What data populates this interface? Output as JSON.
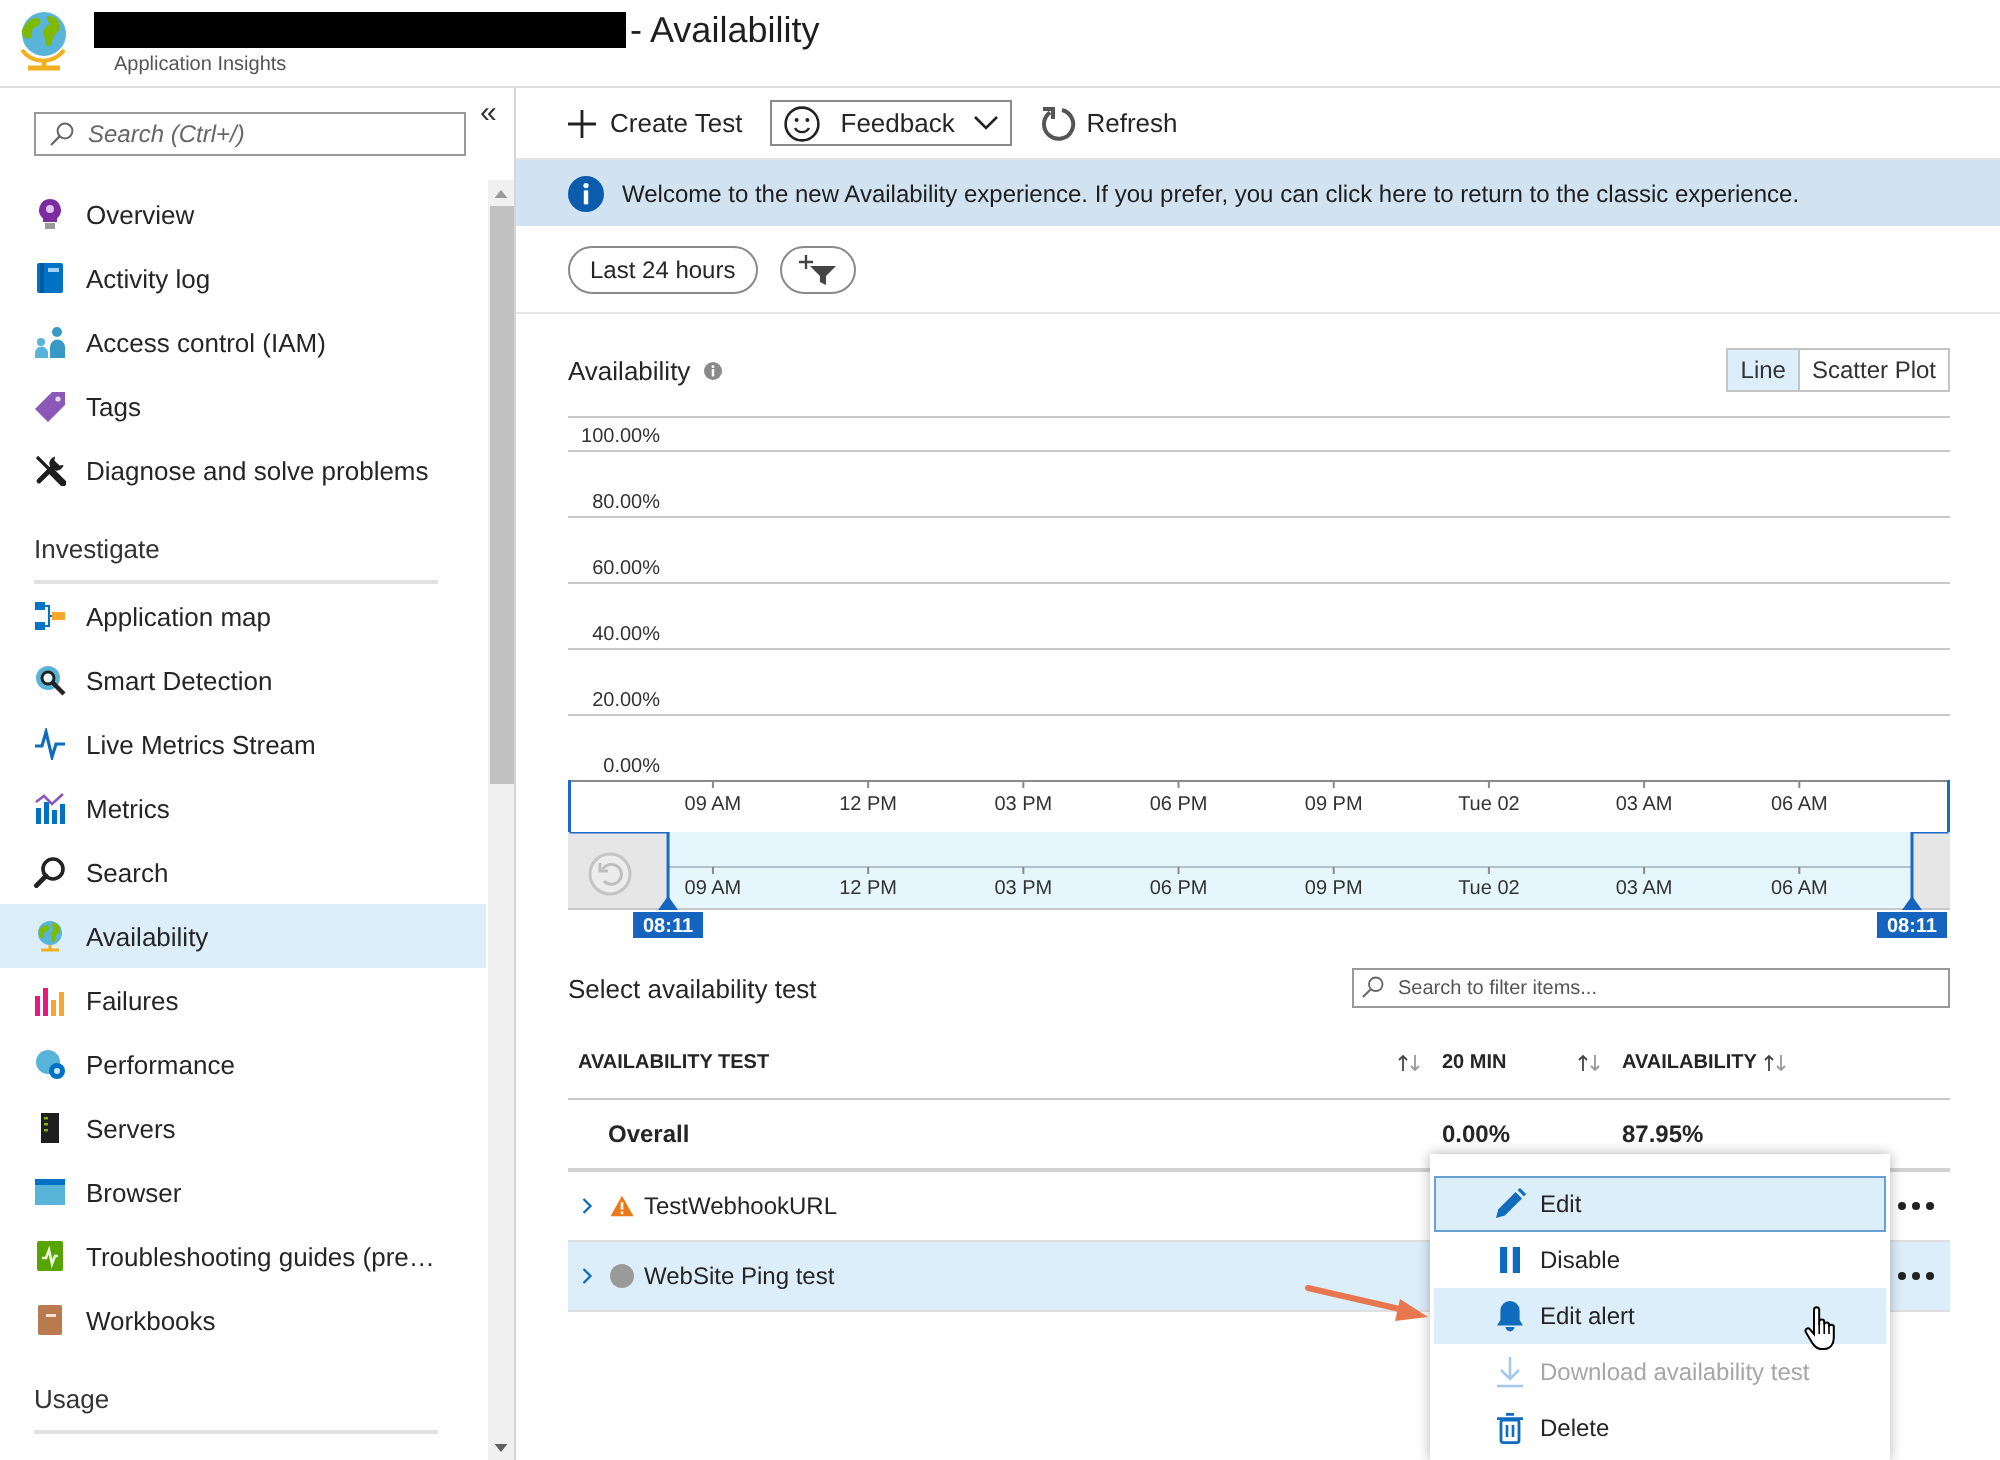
{
  "header": {
    "title": "- Availability",
    "title_redacted": true,
    "subtitle": "Application Insights"
  },
  "sidebar": {
    "search": {
      "placeholder": "Search (Ctrl+/)"
    },
    "collapse": "«",
    "items": [
      {
        "label": "Overview",
        "selected": false
      },
      {
        "label": "Activity log",
        "selected": false
      },
      {
        "label": "Access control (IAM)",
        "selected": false
      },
      {
        "label": "Tags",
        "selected": false
      },
      {
        "label": "Diagnose and solve problems",
        "selected": false
      }
    ],
    "sections": [
      {
        "title": "Investigate",
        "items": [
          {
            "label": "Application map",
            "selected": false
          },
          {
            "label": "Smart Detection",
            "selected": false
          },
          {
            "label": "Live Metrics Stream",
            "selected": false
          },
          {
            "label": "Metrics",
            "selected": false
          },
          {
            "label": "Search",
            "selected": false
          },
          {
            "label": "Availability",
            "selected": true
          },
          {
            "label": "Failures",
            "selected": false
          },
          {
            "label": "Performance",
            "selected": false
          },
          {
            "label": "Servers",
            "selected": false
          },
          {
            "label": "Browser",
            "selected": false
          },
          {
            "label": "Troubleshooting guides (pre…",
            "selected": false
          },
          {
            "label": "Workbooks",
            "selected": false
          }
        ]
      },
      {
        "title": "Usage"
      }
    ]
  },
  "toolbar": {
    "buttons": [
      {
        "label": "Create Test",
        "kind": "add"
      },
      {
        "label": "Feedback",
        "kind": "feedback"
      },
      {
        "label": "Refresh",
        "kind": "refresh"
      }
    ]
  },
  "banner": {
    "text": "Welcome to the new Availability experience. If you prefer, you can click here to return to the classic experience."
  },
  "filters": {
    "time_range": "Last 24 hours"
  },
  "availability_chart": {
    "title": "Availability",
    "view_toggle": [
      {
        "label": "Line",
        "selected": true
      },
      {
        "label": "Scatter Plot",
        "selected": false
      }
    ],
    "chart_data": {
      "type": "line",
      "grid": true,
      "categories": [
        "09 AM",
        "12 PM",
        "03 PM",
        "06 PM",
        "09 PM",
        "Tue 02",
        "03 AM",
        "06 AM"
      ],
      "ylim": [
        0,
        100
      ],
      "yticks": [
        {
          "value": 0,
          "label": "0.00%"
        },
        {
          "value": 20,
          "label": "20.00%"
        },
        {
          "value": 40,
          "label": "40.00%"
        },
        {
          "value": 60,
          "label": "60.00%"
        },
        {
          "value": 80,
          "label": "80.00%"
        },
        {
          "value": 100,
          "label": "100.00%"
        }
      ]
    },
    "time_brush": {
      "tick_labels": [
        "09 AM",
        "12 PM",
        "03 PM",
        "06 PM",
        "09 PM",
        "Tue 02",
        "03 AM",
        "06 AM"
      ],
      "handles": [
        {
          "label": "08:11",
          "level": 0.0724
        },
        {
          "label": "08:11",
          "level": 0.9725
        }
      ]
    }
  },
  "tests": {
    "title": "Select availability test",
    "search": {
      "placeholder": "Search to filter items..."
    },
    "columns": [
      {
        "label": "AVAILABILITY TEST"
      },
      {
        "label": "20 MIN"
      },
      {
        "label": "AVAILABILITY"
      }
    ],
    "rows": [
      {
        "kind": "summary",
        "name": "Overall",
        "cells": [
          "0.00%",
          "87.95%"
        ],
        "selected": false
      },
      {
        "kind": "test",
        "name": "TestWebhookURL",
        "warning": true,
        "expanded": false,
        "selected": false
      },
      {
        "kind": "test",
        "name": "WebSite Ping test",
        "warning": false,
        "expanded": false,
        "selected": true
      }
    ]
  },
  "context_menu": {
    "items": [
      {
        "label": "Edit",
        "focused": true,
        "hovered": false,
        "disabled": false
      },
      {
        "label": "Disable",
        "focused": false,
        "hovered": false,
        "disabled": false
      },
      {
        "label": "Edit alert",
        "focused": false,
        "hovered": true,
        "disabled": false
      },
      {
        "label": "Download availability test",
        "focused": false,
        "hovered": false,
        "disabled": true
      },
      {
        "label": "Delete",
        "focused": false,
        "hovered": false,
        "disabled": false
      }
    ]
  }
}
